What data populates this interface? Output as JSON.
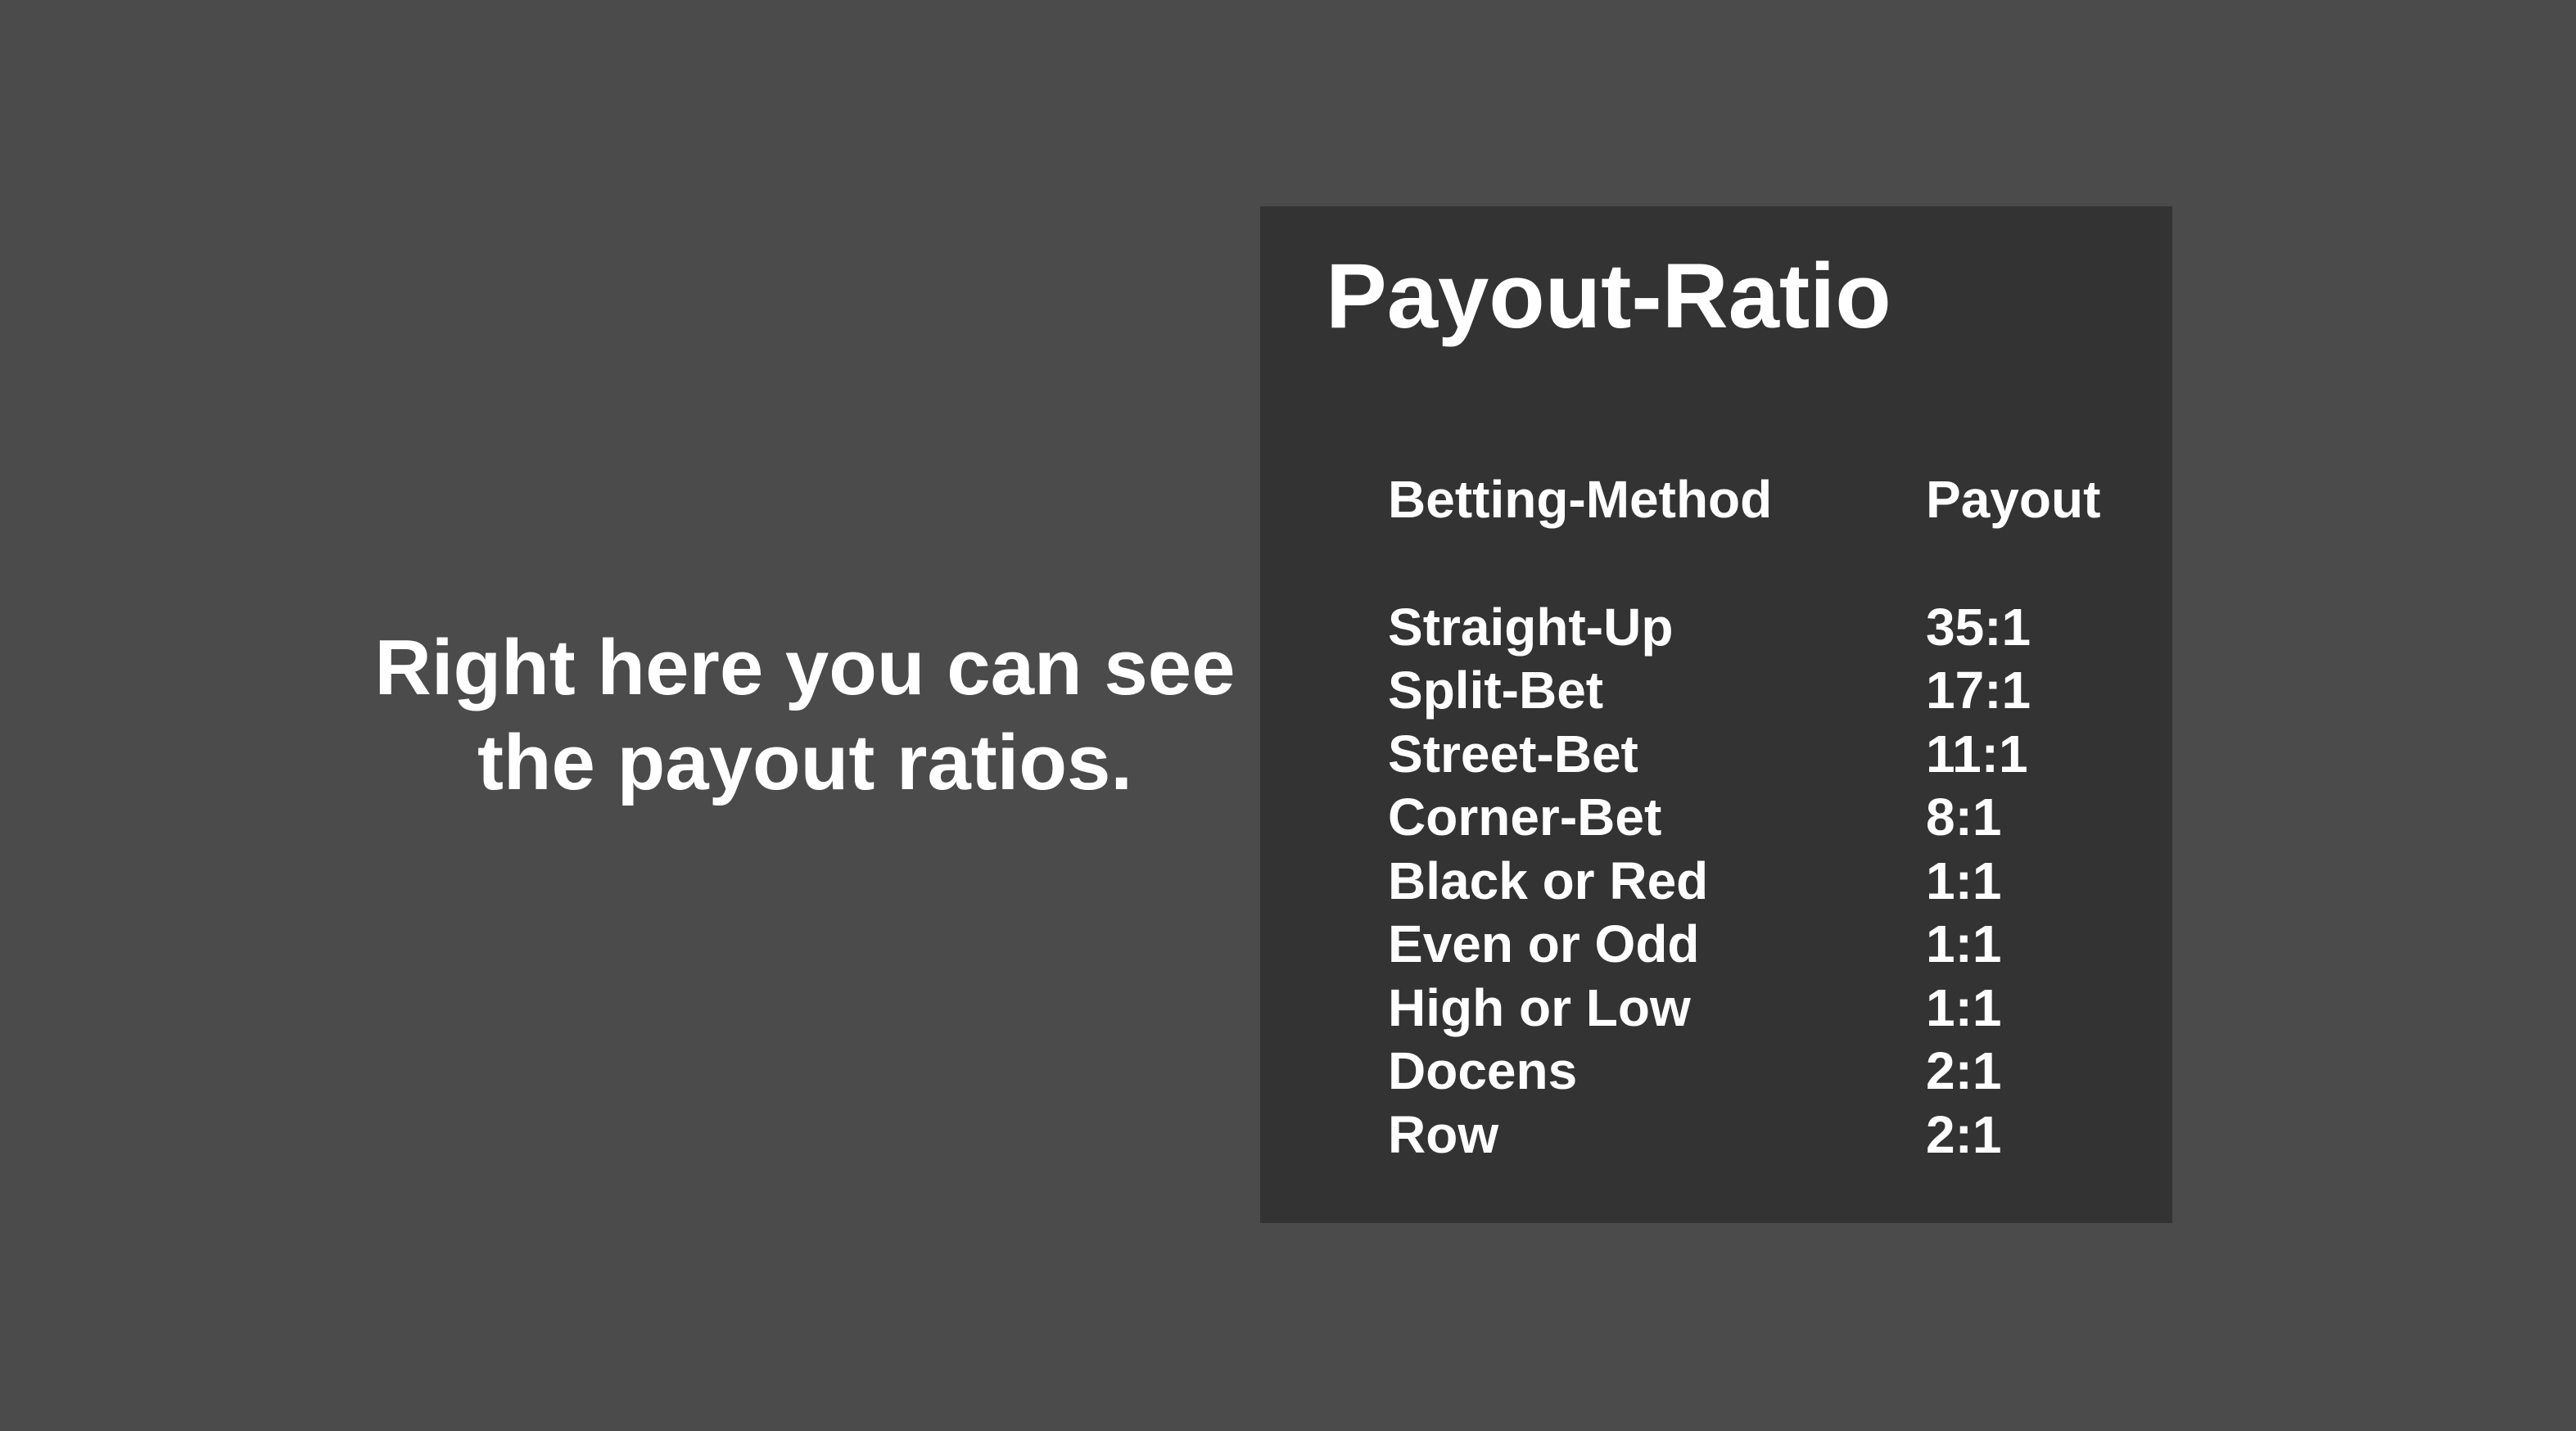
{
  "caption": "Right here you can see the payout ratios.",
  "panel": {
    "title": "Payout-Ratio",
    "headers": {
      "method": "Betting-Method",
      "payout": "Payout"
    },
    "rows": [
      {
        "method": "Straight-Up",
        "payout": "35:1"
      },
      {
        "method": "Split-Bet",
        "payout": "17:1"
      },
      {
        "method": "Street-Bet",
        "payout": "11:1"
      },
      {
        "method": "Corner-Bet",
        "payout": "8:1"
      },
      {
        "method": "Black or Red",
        "payout": "1:1"
      },
      {
        "method": "Even or Odd",
        "payout": "1:1"
      },
      {
        "method": "High or Low",
        "payout": "1:1"
      },
      {
        "method": "Docens",
        "payout": "2:1"
      },
      {
        "method": "Row",
        "payout": "2:1"
      }
    ]
  },
  "colors": {
    "background": "#4b4b4b",
    "panel": "#333333",
    "text": "#ffffff"
  }
}
